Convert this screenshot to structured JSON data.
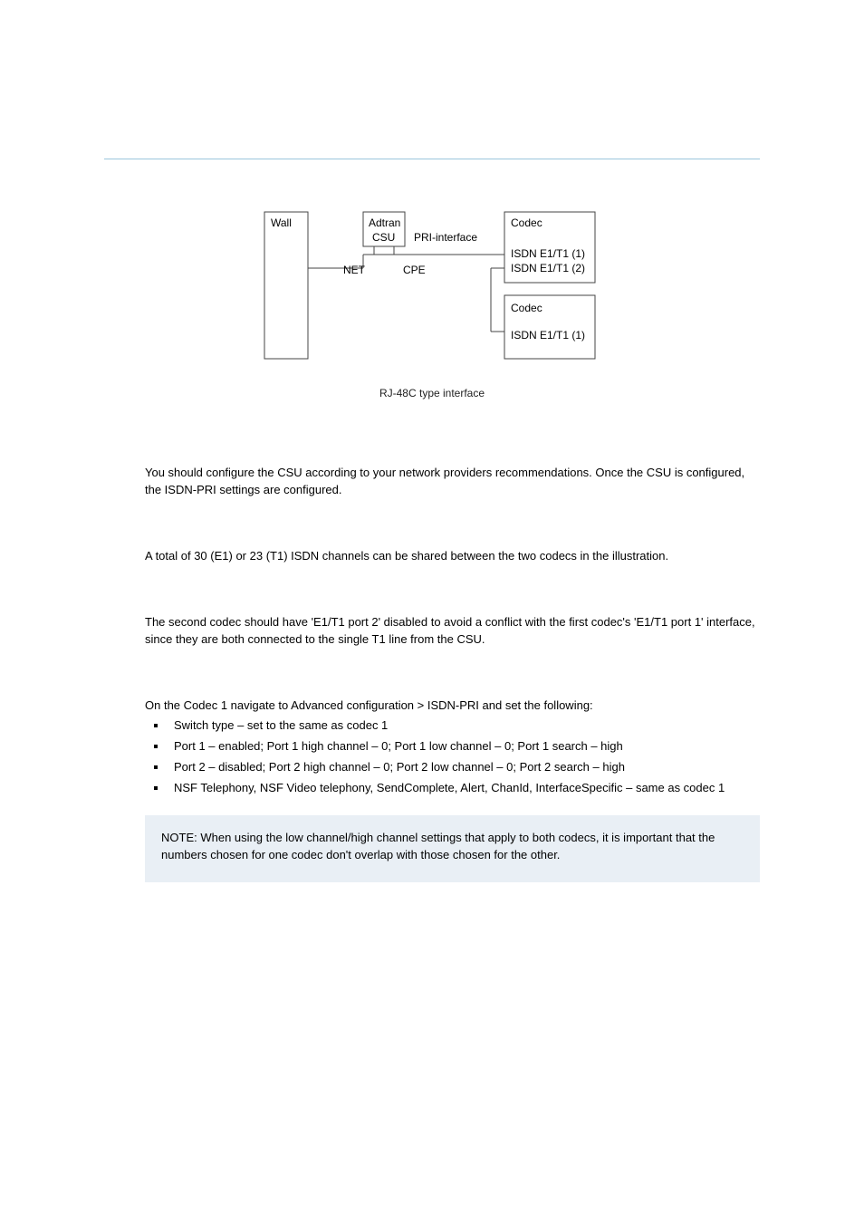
{
  "diagram": {
    "wall": "Wall",
    "adtran_line1": "Adtran",
    "adtran_line2": "CSU",
    "pri_label": "PRI-interface",
    "net_label": "NET",
    "cpe_label": "CPE",
    "codec1_title": "Codec",
    "codec1_line1": "ISDN E1/T1 (1)",
    "codec1_line2": "ISDN E1/T1 (2)",
    "codec2_title": "Codec",
    "codec2_line1": "ISDN E1/T1 (1)",
    "caption": "RJ-48C type interface"
  },
  "body": {
    "p1": "You should configure the CSU according to your network providers recommendations. Once the CSU is configured, the ISDN-PRI settings are configured.",
    "p2": "A total of 30 (E1) or 23 (T1) ISDN channels can be shared between the two codecs in the illustration.",
    "p3": "The second codec should have 'E1/T1 port 2' disabled to avoid a conflict with the first codec's 'E1/T1 port 1' interface, since they are both connected to the single T1 line from the CSU.",
    "p4": "On the Codec 1 navigate to Advanced configuration > ISDN-PRI and set the following:",
    "li1": "Switch type – set to the same as codec 1",
    "li2": "Port 1 – enabled; Port 1 high channel – 0; Port 1 low channel – 0; Port 1 search – high",
    "li3": "Port 2 – disabled; Port 2 high channel – 0; Port 2 low channel – 0; Port 2 search – high",
    "li4": "NSF Telephony, NSF Video telephony, SendComplete, Alert, ChanId, InterfaceSpecific – same as codec 1",
    "note": "NOTE: When using the low channel/high channel settings that apply to both codecs, it is important that the numbers chosen for one codec don't overlap with those chosen for the other."
  }
}
